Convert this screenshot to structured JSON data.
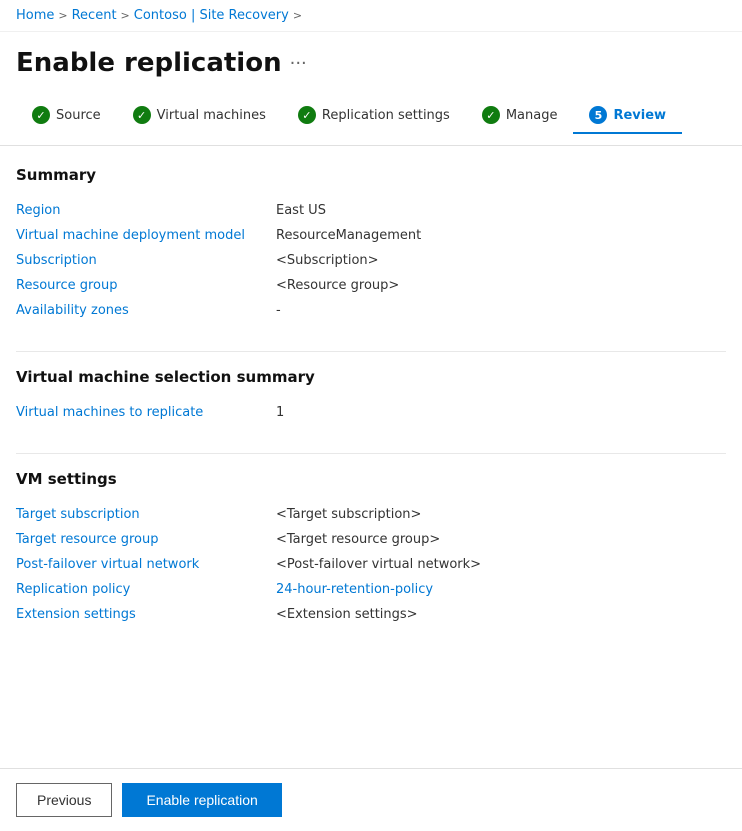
{
  "breadcrumb": {
    "items": [
      "Home",
      "Recent",
      "Contoso | Site Recovery"
    ],
    "separators": [
      ">",
      ">",
      ">"
    ]
  },
  "page": {
    "title": "Enable replication",
    "more_icon": "•••"
  },
  "tabs": [
    {
      "id": "source",
      "label": "Source",
      "state": "completed",
      "step": null
    },
    {
      "id": "vms",
      "label": "Virtual machines",
      "state": "completed",
      "step": null
    },
    {
      "id": "replication-settings",
      "label": "Replication settings",
      "state": "completed",
      "step": null
    },
    {
      "id": "manage",
      "label": "Manage",
      "state": "completed",
      "step": null
    },
    {
      "id": "review",
      "label": "Review",
      "state": "active",
      "step": "5"
    }
  ],
  "summary": {
    "title": "Summary",
    "rows": [
      {
        "label": "Region",
        "value": "East US",
        "link": false
      },
      {
        "label": "Virtual machine deployment model",
        "value": "ResourceManagement",
        "link": false
      },
      {
        "label": "Subscription",
        "value": "<Subscription>",
        "link": false
      },
      {
        "label": "Resource group",
        "value": "<Resource group>",
        "link": false
      },
      {
        "label": "Availability zones",
        "value": "-",
        "link": false
      }
    ]
  },
  "vm_selection_summary": {
    "title": "Virtual machine selection summary",
    "rows": [
      {
        "label": "Virtual machines to replicate",
        "value": "1",
        "link": false
      }
    ]
  },
  "vm_settings": {
    "title": "VM settings",
    "rows": [
      {
        "label": "Target subscription",
        "value": "<Target subscription>",
        "link": false
      },
      {
        "label": "Target resource group",
        "value": "<Target resource group>",
        "link": false
      },
      {
        "label": "Post-failover virtual network",
        "value": "<Post-failover virtual network>",
        "link": false
      },
      {
        "label": "Replication policy",
        "value": "24-hour-retention-policy",
        "link": true
      },
      {
        "label": "Extension settings",
        "value": "<Extension settings>",
        "link": false
      }
    ]
  },
  "footer": {
    "previous_label": "Previous",
    "enable_label": "Enable replication"
  },
  "icons": {
    "checkmark": "✓",
    "more": "···"
  }
}
